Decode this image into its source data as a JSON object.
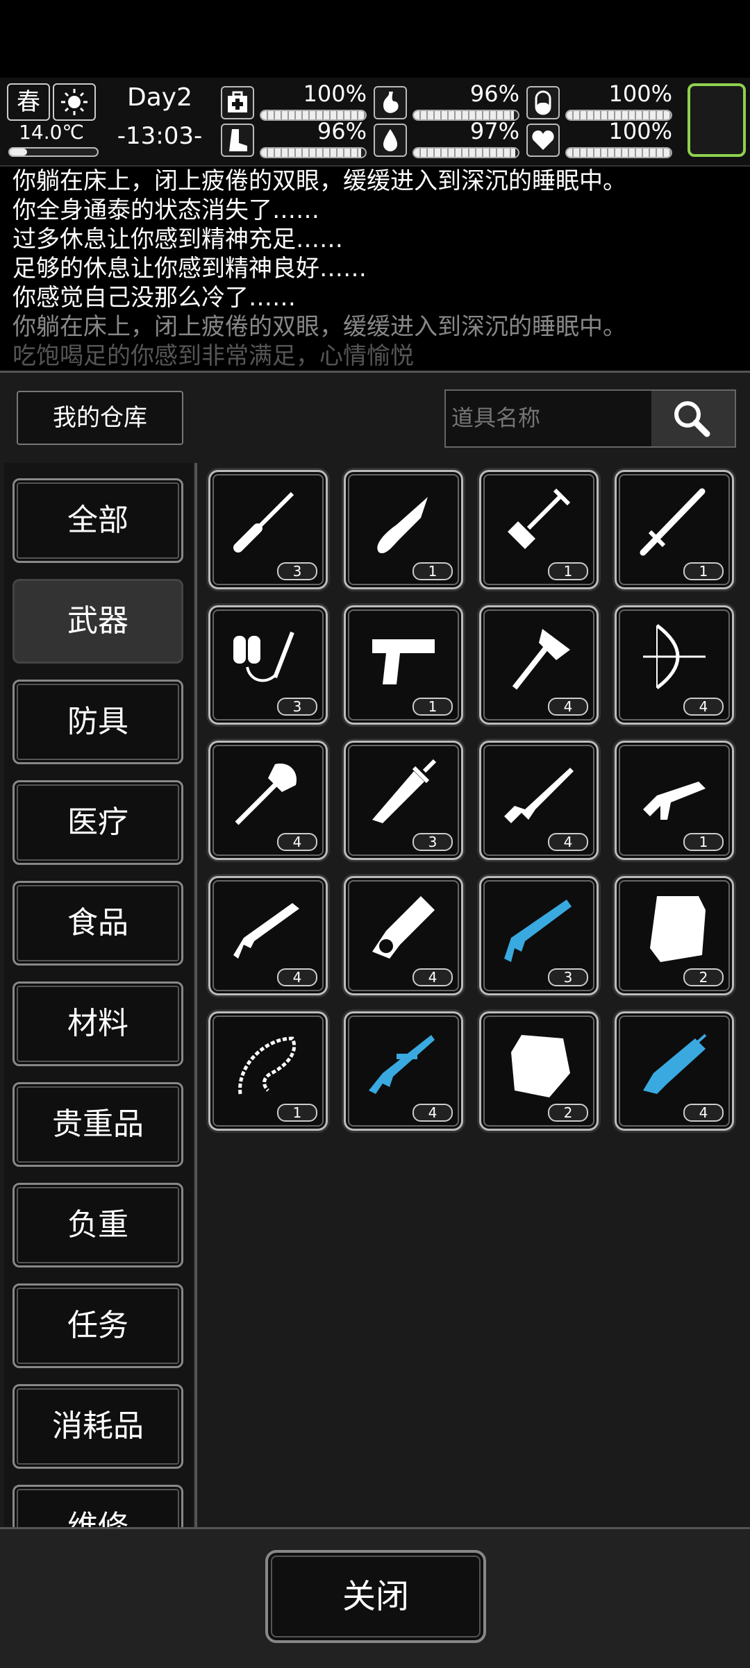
{
  "hud": {
    "season": "春",
    "temperature": "14.0℃",
    "temperature_level": 0.2,
    "day": "Day2",
    "time": "-13:03-",
    "stats": [
      {
        "name": "health",
        "icon": "first-aid-icon",
        "value": "100%",
        "level": 1.0
      },
      {
        "name": "hunger",
        "icon": "stomach-icon",
        "value": "96%",
        "level": 0.96
      },
      {
        "name": "energy",
        "icon": "pill-icon",
        "value": "100%",
        "level": 1.0
      },
      {
        "name": "stamina",
        "icon": "boot-icon",
        "value": "96%",
        "level": 0.96
      },
      {
        "name": "thirst",
        "icon": "water-drop-icon",
        "value": "97%",
        "level": 0.97
      },
      {
        "name": "mood",
        "icon": "heart-icon",
        "value": "100%",
        "level": 1.0
      }
    ]
  },
  "log": [
    "你躺在床上，闭上疲倦的双眼，缓缓进入到深沉的睡眠中。",
    "你全身通泰的状态消失了……",
    "过多休息让你感到精神充足……",
    "足够的休息让你感到精神良好……",
    "你感觉自己没那么冷了……",
    "你躺在床上，闭上疲倦的双眼，缓缓进入到深沉的睡眠中。",
    "吃饱喝足的你感到非常满足，心情愉悦"
  ],
  "warehouse": {
    "title": "我的仓库",
    "search_placeholder": "道具名称"
  },
  "categories": [
    "全部",
    "武器",
    "防具",
    "医疗",
    "食品",
    "材料",
    "贵重品",
    "负重",
    "任务",
    "消耗品",
    "维修"
  ],
  "active_category": "武器",
  "items": [
    {
      "icon": "screwdriver-icon",
      "count": "3",
      "color": "#ffffff"
    },
    {
      "icon": "folding-knife-icon",
      "count": "1",
      "color": "#ffffff"
    },
    {
      "icon": "shovel-icon",
      "count": "1",
      "color": "#ffffff"
    },
    {
      "icon": "baton-icon",
      "count": "1",
      "color": "#ffffff"
    },
    {
      "icon": "flamethrower-icon",
      "count": "3",
      "color": "#ffffff"
    },
    {
      "icon": "pistol-icon",
      "count": "1",
      "color": "#ffffff"
    },
    {
      "icon": "axe-icon",
      "count": "4",
      "color": "#ffffff"
    },
    {
      "icon": "compound-bow-icon",
      "count": "4",
      "color": "#ffffff"
    },
    {
      "icon": "spade-icon",
      "count": "4",
      "color": "#ffffff"
    },
    {
      "icon": "sword-icon",
      "count": "3",
      "color": "#ffffff"
    },
    {
      "icon": "assault-rifle-icon",
      "count": "4",
      "color": "#ffffff"
    },
    {
      "icon": "smg-icon",
      "count": "1",
      "color": "#ffffff"
    },
    {
      "icon": "rifle-icon",
      "count": "4",
      "color": "#ffffff"
    },
    {
      "icon": "chainsaw-icon",
      "count": "4",
      "color": "#ffffff"
    },
    {
      "icon": "shotgun-icon",
      "count": "3",
      "color": "#3aa9e0"
    },
    {
      "icon": "riot-shield-icon",
      "count": "2",
      "color": "#ffffff"
    },
    {
      "icon": "chain-whip-icon",
      "count": "1",
      "color": "#ffffff"
    },
    {
      "icon": "sniper-rifle-icon",
      "count": "4",
      "color": "#3aa9e0"
    },
    {
      "icon": "armor-plate-icon",
      "count": "2",
      "color": "#ffffff"
    },
    {
      "icon": "minigun-icon",
      "count": "4",
      "color": "#3aa9e0"
    }
  ],
  "close_label": "关闭"
}
